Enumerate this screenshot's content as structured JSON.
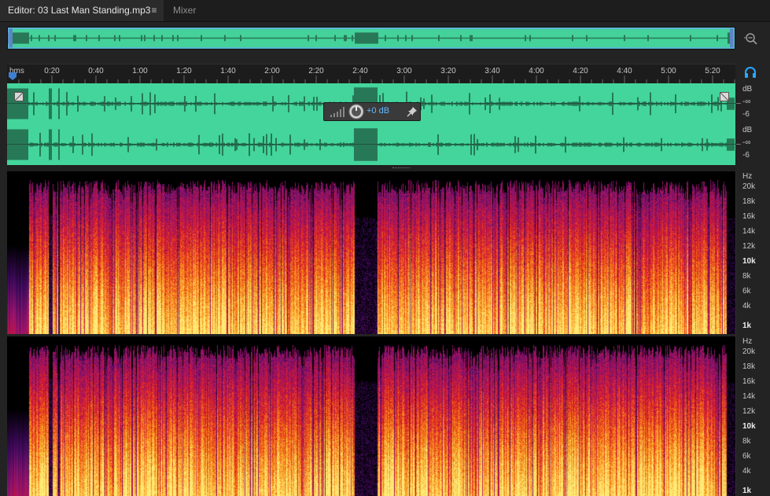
{
  "tabs": {
    "editor_label": "Editor: 03 Last Man Standing.mp3",
    "mixer_label": "Mixer"
  },
  "ruler": {
    "unit_label": "hms",
    "ticks": [
      "0:20",
      "0:40",
      "1:00",
      "1:20",
      "1:40",
      "2:00",
      "2:20",
      "2:40",
      "3:00",
      "3:20",
      "3:40",
      "4:00",
      "4:20",
      "4:40",
      "5:00",
      "5:20"
    ]
  },
  "waveform": {
    "color": "#43d59b",
    "channel1_db": {
      "unit": "dB",
      "inf": "-∞",
      "minus6": "-6"
    },
    "channel2_db": {
      "unit": "dB",
      "inf": "-∞",
      "minus6": "-6"
    }
  },
  "hud": {
    "volume_label": "+0 dB"
  },
  "spectrogram": {
    "channel1_scale": [
      "Hz",
      "20k",
      "18k",
      "16k",
      "14k",
      "12k",
      "10k",
      "8k",
      "6k",
      "4k",
      "1k"
    ],
    "channel2_scale": [
      "Hz",
      "20k",
      "18k",
      "16k",
      "14k",
      "12k",
      "10k",
      "8k",
      "6k",
      "4k",
      "1k"
    ]
  },
  "icons": {
    "tab_menu": "menu-icon",
    "zoom": "zoom-out-icon",
    "headphones": "headphones-icon",
    "pin": "pin-icon",
    "knob": "volume-knob-icon"
  }
}
